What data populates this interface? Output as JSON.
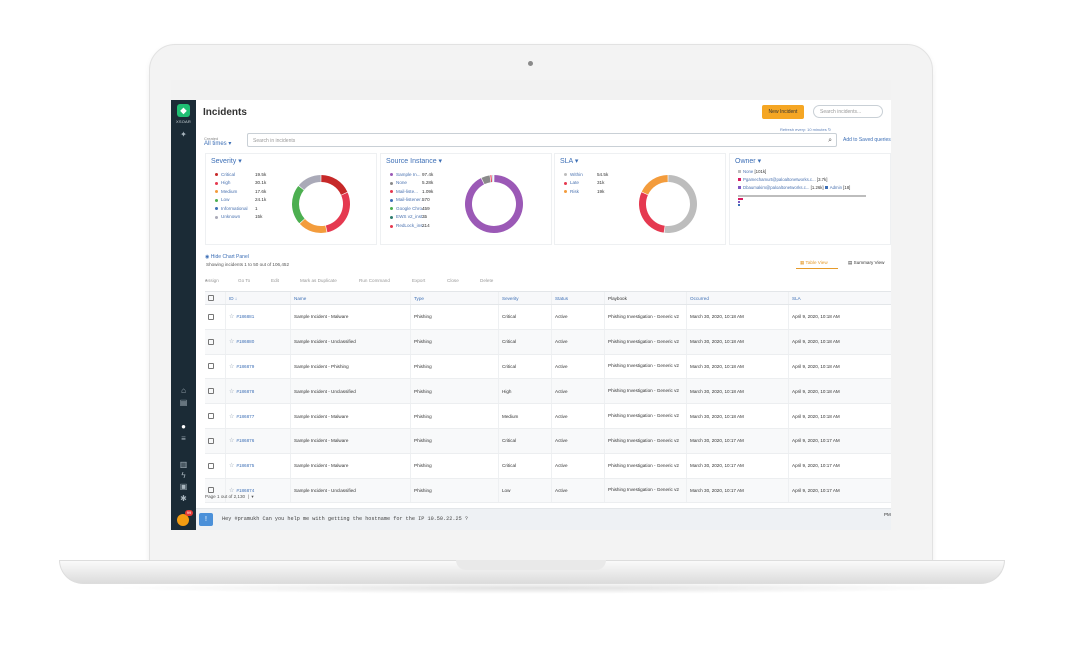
{
  "header": {
    "title": "Incidents",
    "new_incident": "New Incident",
    "search_placeholder": "Search incidents...",
    "refresh": "Refresh every: 10 minutes",
    "created_label": "Created",
    "created_value": "All times",
    "query_placeholder": "Search in incidents",
    "add_saved": "Add to Saved queries"
  },
  "sidebar": {
    "logo": "XSOAR",
    "icons": [
      "home-icon",
      "dashboard-icon",
      "incidents-icon",
      "jobs-icon",
      "playbooks-icon",
      "automation-icon",
      "marketplace-icon",
      "settings-icon"
    ],
    "badge": "99"
  },
  "chart_data": [
    {
      "type": "pie",
      "title": "Severity",
      "categories": [
        "Critical",
        "High",
        "Medium",
        "Low",
        "Informational",
        "Unknown"
      ],
      "value_labels": [
        "19.5k",
        "30.1k",
        "17.6k",
        "24.1k",
        "1",
        "15k"
      ],
      "values": [
        19500,
        30100,
        17600,
        24100,
        1,
        15000
      ],
      "colors": [
        "#c62828",
        "#e53950",
        "#f39c3c",
        "#4caf50",
        "#3d6fb6",
        "#aaaab8"
      ]
    },
    {
      "type": "pie",
      "title": "Source Instance",
      "categories": [
        "Sample In...",
        "None",
        "Mail-liste...",
        "Mail-listener...",
        "Google Chro...",
        "EWS v2_inst...",
        "RedLock_ins..."
      ],
      "value_labels": [
        "97.4k",
        "5.28k",
        "1.09k",
        "570",
        "459",
        "35",
        "214"
      ],
      "values": [
        97400,
        5280,
        1090,
        570,
        459,
        35,
        214
      ],
      "colors": [
        "#9b59b6",
        "#8a8a8a",
        "#e53950",
        "#3d6fb6",
        "#4caf50",
        "#2e7d6e",
        "#e53950"
      ]
    },
    {
      "type": "pie",
      "title": "SLA",
      "categories": [
        "Within",
        "Late",
        "Risk"
      ],
      "value_labels": [
        "54.5k",
        "31k",
        "19k"
      ],
      "values": [
        54500,
        31000,
        19000
      ],
      "colors": [
        "#bdbdbd",
        "#e53950",
        "#f39c3c"
      ]
    },
    {
      "type": "bar",
      "title": "Owner",
      "categories": [
        "None",
        "Pgamechamurt@paloaltonetworks.c...",
        "Dbaumakim@paloaltonetworks.c...",
        "Admin"
      ],
      "value_labels": [
        "[101k]",
        "[3.7k]",
        "[1.26k]",
        "[18]"
      ],
      "values": [
        101000,
        3700,
        1260,
        18
      ],
      "colors": [
        "#bdbdbd",
        "#d81b60",
        "#7e57c2",
        "#3d6fb6"
      ]
    }
  ],
  "panel": {
    "hide": "Hide Chart Panel",
    "showing": "Showing incidents 1 to 50 out of 106,452",
    "table_view": "Table View",
    "summary_view": "Summary View"
  },
  "toolbar": [
    "Assign",
    "Go To",
    "Edit",
    "Mark as Duplicate",
    "Run Command",
    "Export",
    "Close",
    "Delete"
  ],
  "table": {
    "columns": [
      "ID",
      "Name",
      "Type",
      "Severity",
      "Status",
      "Playbook",
      "Occurred",
      "SLA"
    ],
    "rows": [
      {
        "id": "#186881",
        "name": "Sample Incident - Malware",
        "type": "Phishing",
        "severity": "Critical",
        "status": "Active",
        "playbook": "Phishing Investigation - Generic v2",
        "occurred": "March 30, 2020, 10:18 AM",
        "sla": "April 9, 2020, 10:18 AM"
      },
      {
        "id": "#186880",
        "name": "Sample Incident - Unclassified",
        "type": "Phishing",
        "severity": "Critical",
        "status": "Active",
        "playbook": "Phishing Investigation - Generic v2",
        "occurred": "March 30, 2020, 10:18 AM",
        "sla": "April 9, 2020, 10:18 AM"
      },
      {
        "id": "#186879",
        "name": "Sample Incident - Phishing",
        "type": "Phishing",
        "severity": "Critical",
        "status": "Active",
        "playbook": "Phishing Investigation - Generic v2",
        "occurred": "March 30, 2020, 10:18 AM",
        "sla": "April 9, 2020, 10:18 AM"
      },
      {
        "id": "#186878",
        "name": "Sample Incident - Unclassified",
        "type": "Phishing",
        "severity": "High",
        "status": "Active",
        "playbook": "Phishing Investigation - Generic v2",
        "occurred": "March 30, 2020, 10:18 AM",
        "sla": "April 9, 2020, 10:18 AM"
      },
      {
        "id": "#186877",
        "name": "Sample Incident - Malware",
        "type": "Phishing",
        "severity": "Medium",
        "status": "Active",
        "playbook": "Phishing Investigation - Generic v2",
        "occurred": "March 30, 2020, 10:18 AM",
        "sla": "April 9, 2020, 10:18 AM"
      },
      {
        "id": "#186876",
        "name": "Sample Incident - Malware",
        "type": "Phishing",
        "severity": "Critical",
        "status": "Active",
        "playbook": "Phishing Investigation - Generic v2",
        "occurred": "March 30, 2020, 10:17 AM",
        "sla": "April 9, 2020, 10:17 AM"
      },
      {
        "id": "#186875",
        "name": "Sample Incident - Malware",
        "type": "Phishing",
        "severity": "Critical",
        "status": "Active",
        "playbook": "Phishing Investigation - Generic v2",
        "occurred": "March 30, 2020, 10:17 AM",
        "sla": "April 9, 2020, 10:17 AM"
      },
      {
        "id": "#186874",
        "name": "Sample Incident - Unclassified",
        "type": "Phishing",
        "severity": "Low",
        "status": "Active",
        "playbook": "Phishing Investigation - Generic v2",
        "occurred": "March 30, 2020, 10:17 AM",
        "sla": "April 9, 2020, 10:17 AM"
      }
    ]
  },
  "pager": "Page 1 out of 2,130",
  "chat": {
    "button": "!",
    "text": "Hey #pramukh Can you help me with getting the hostname for the IP 10.50.22.25 ?",
    "right": "PM"
  }
}
